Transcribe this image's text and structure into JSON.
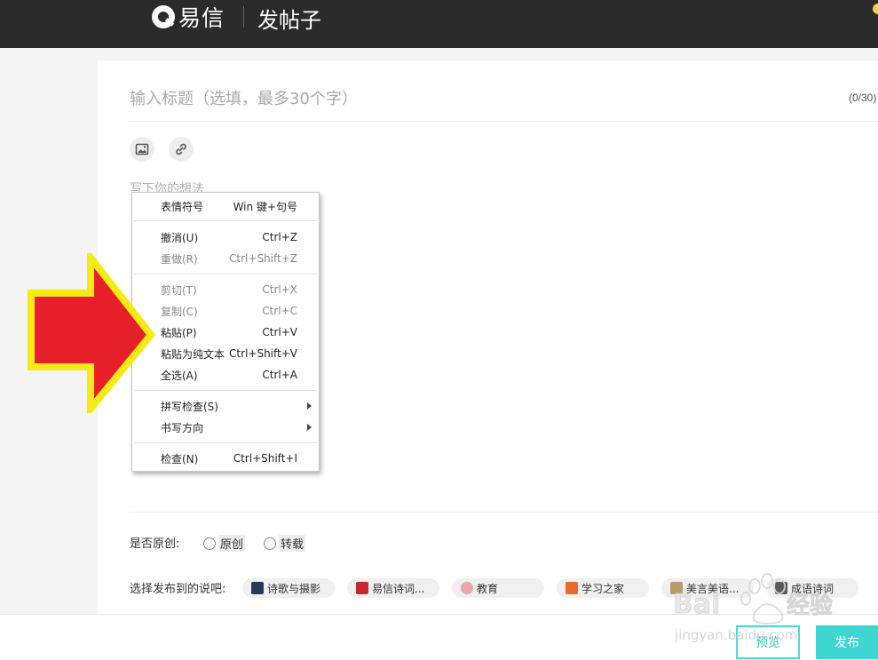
{
  "header": {
    "app_name": "易信",
    "page_title": "发帖子"
  },
  "editor": {
    "title_placeholder": "输入标题（选填，最多30个字）",
    "title_counter": "(0/30)",
    "content_placeholder": "写下你的想法",
    "tools": [
      {
        "name": "image",
        "icon": "image-icon"
      },
      {
        "name": "link",
        "icon": "link-icon"
      }
    ]
  },
  "context_menu": {
    "items": [
      {
        "label": "表情符号",
        "shortcut": "Win 键+句号",
        "disabled": false,
        "submenu": false
      },
      {
        "label": "撤消(U)",
        "shortcut": "Ctrl+Z",
        "disabled": false,
        "submenu": false
      },
      {
        "label": "重做(R)",
        "shortcut": "Ctrl+Shift+Z",
        "disabled": true,
        "submenu": false
      },
      {
        "label": "剪切(T)",
        "shortcut": "Ctrl+X",
        "disabled": true,
        "submenu": false
      },
      {
        "label": "复制(C)",
        "shortcut": "Ctrl+C",
        "disabled": true,
        "submenu": false
      },
      {
        "label": "粘贴(P)",
        "shortcut": "Ctrl+V",
        "disabled": false,
        "submenu": false
      },
      {
        "label": "粘贴为纯文本",
        "shortcut": "Ctrl+Shift+V",
        "disabled": false,
        "submenu": false
      },
      {
        "label": "全选(A)",
        "shortcut": "Ctrl+A",
        "disabled": false,
        "submenu": false
      },
      {
        "label": "拼写检查(S)",
        "shortcut": "",
        "disabled": false,
        "submenu": true
      },
      {
        "label": "书写方向",
        "shortcut": "",
        "disabled": false,
        "submenu": true
      },
      {
        "label": "检查(N)",
        "shortcut": "Ctrl+Shift+I",
        "disabled": false,
        "submenu": false
      }
    ]
  },
  "original": {
    "label": "是否原创:",
    "options": [
      "原创",
      "转载"
    ]
  },
  "forums": {
    "label": "选择发布到的说吧:",
    "chips": [
      {
        "label": "诗歌与摄影",
        "icon_color": "#1f3a5a"
      },
      {
        "label": "易信诗词...",
        "icon_color": "#c8282a"
      },
      {
        "label": "教育",
        "icon_color": "#e8a6a6"
      },
      {
        "label": "学习之家",
        "icon_color": "#e86a2a"
      },
      {
        "label": "美言美语...",
        "icon_color": "#b89a6a"
      },
      {
        "label": "成语诗词",
        "icon_color": "#5a5a5a"
      }
    ]
  },
  "actions": {
    "preview_label": "预览",
    "publish_label": "发布"
  },
  "colors": {
    "topbar": "#2b2b2b",
    "accent": "#3dd6d3",
    "arrow_fill": "#e8202a",
    "arrow_border": "#f5ea14"
  },
  "watermark": {
    "brand": "Baidu 经验",
    "url": "jingyan.baidu.com"
  }
}
